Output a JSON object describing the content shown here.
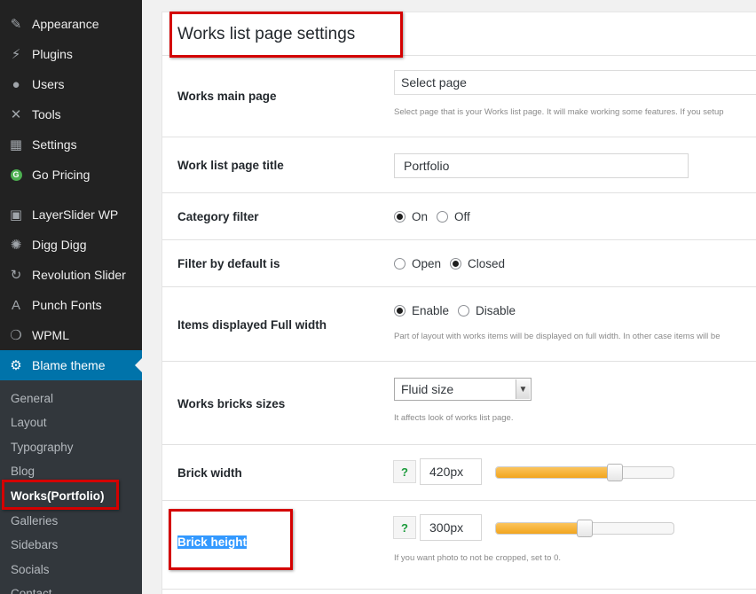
{
  "sidebar": {
    "menu": [
      {
        "label": "Appearance",
        "icon": "brush-icon",
        "glyph": "✎"
      },
      {
        "label": "Plugins",
        "icon": "plug-icon",
        "glyph": "⚡"
      },
      {
        "label": "Users",
        "icon": "user-icon",
        "glyph": "●"
      },
      {
        "label": "Tools",
        "icon": "wrench-icon",
        "glyph": "✕"
      },
      {
        "label": "Settings",
        "icon": "sliders-icon",
        "glyph": "▦"
      },
      {
        "label": "Go Pricing",
        "icon": "go-pricing-icon",
        "glyph": "G"
      },
      {
        "label": "LayerSlider WP",
        "icon": "layers-icon",
        "glyph": "▣"
      },
      {
        "label": "Digg Digg",
        "icon": "gear-icon",
        "glyph": "✺"
      },
      {
        "label": "Revolution Slider",
        "icon": "refresh-icon",
        "glyph": "↻"
      },
      {
        "label": "Punch Fonts",
        "icon": "font-icon",
        "glyph": "A"
      },
      {
        "label": "WPML",
        "icon": "wpml-icon",
        "glyph": "❍"
      },
      {
        "label": "Blame theme",
        "icon": "cog-icon",
        "glyph": "⚙"
      }
    ],
    "submenu": [
      "General",
      "Layout",
      "Typography",
      "Blog",
      "Works(Portfolio)",
      "Galleries",
      "Sidebars",
      "Socials",
      "Contact"
    ]
  },
  "panel": {
    "title": "Works list page settings",
    "works_main_page": {
      "label": "Works main page",
      "value": "Select page",
      "hint": "Select page that is your Works list page. It will make working some features. If you setup"
    },
    "work_list_title": {
      "label": "Work list page title",
      "value": "Portfolio"
    },
    "category_filter": {
      "label": "Category filter",
      "options": [
        "On",
        "Off"
      ],
      "selected": "On"
    },
    "filter_default": {
      "label": "Filter by default is",
      "options": [
        "Open",
        "Closed"
      ],
      "selected": "Closed"
    },
    "items_full_width": {
      "label": "Items displayed Full width",
      "options": [
        "Enable",
        "Disable"
      ],
      "selected": "Enable",
      "hint": "Part of layout with works items will be displayed on full width. In other case items will be"
    },
    "bricks_sizes": {
      "label": "Works bricks sizes",
      "value": "Fluid size",
      "hint": "It affects look of works list page."
    },
    "brick_width": {
      "label": "Brick width",
      "help": "?",
      "value": "420px",
      "level": 0.67
    },
    "brick_height": {
      "label": "Brick height",
      "help": "?",
      "value": "300px",
      "level": 0.5,
      "hint": "If you want photo to not be cropped, set to 0."
    }
  }
}
